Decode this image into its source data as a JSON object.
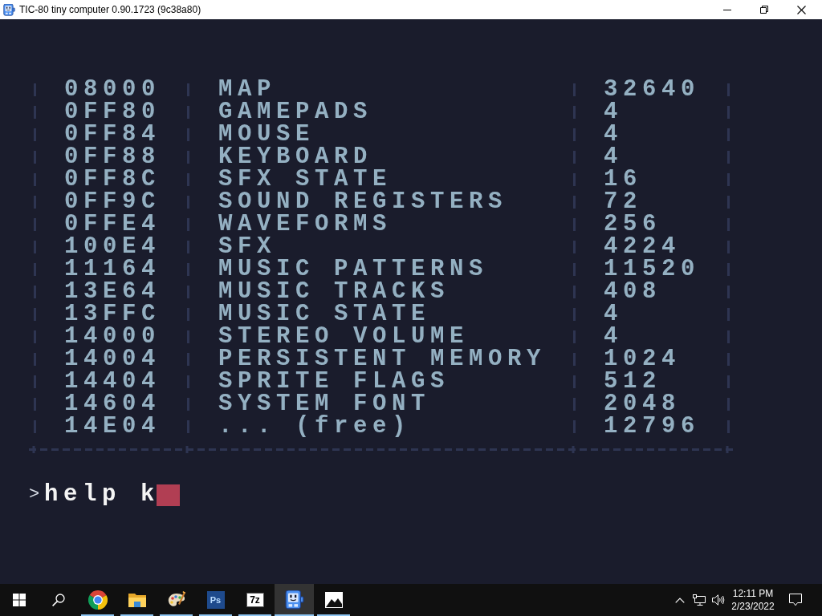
{
  "window": {
    "title": "TIC-80 tiny computer 0.90.1723 (9c38a80)"
  },
  "memory_map": [
    {
      "address": "08000",
      "region": "MAP",
      "size": "32640"
    },
    {
      "address": "0FF80",
      "region": "GAMEPADS",
      "size": "4"
    },
    {
      "address": "0FF84",
      "region": "MOUSE",
      "size": "4"
    },
    {
      "address": "0FF88",
      "region": "KEYBOARD",
      "size": "4"
    },
    {
      "address": "0FF8C",
      "region": "SFX STATE",
      "size": "16"
    },
    {
      "address": "0FF9C",
      "region": "SOUND REGISTERS",
      "size": "72"
    },
    {
      "address": "0FFE4",
      "region": "WAVEFORMS",
      "size": "256"
    },
    {
      "address": "100E4",
      "region": "SFX",
      "size": "4224"
    },
    {
      "address": "11164",
      "region": "MUSIC PATTERNS",
      "size": "11520"
    },
    {
      "address": "13E64",
      "region": "MUSIC TRACKS",
      "size": "408"
    },
    {
      "address": "13FFC",
      "region": "MUSIC STATE",
      "size": "4"
    },
    {
      "address": "14000",
      "region": "STEREO VOLUME",
      "size": "4"
    },
    {
      "address": "14004",
      "region": "PERSISTENT MEMORY",
      "size": "1024"
    },
    {
      "address": "14404",
      "region": "SPRITE FLAGS",
      "size": "512"
    },
    {
      "address": "14604",
      "region": "SYSTEM FONT",
      "size": "2048"
    },
    {
      "address": "14E04",
      "region": "... (free)",
      "size": "12796"
    }
  ],
  "prompt": {
    "symbol": ">",
    "input": "help k",
    "cursor": true
  },
  "taskbar": {
    "apps": [
      {
        "kind": "browser",
        "running": true,
        "selected": false
      },
      {
        "kind": "folder",
        "running": true,
        "selected": false
      },
      {
        "kind": "palette",
        "running": true,
        "selected": false
      },
      {
        "kind": "darktile",
        "label": "Ps",
        "running": true,
        "selected": false
      },
      {
        "kind": "lighttile",
        "label": "7z",
        "running": true,
        "selected": false
      },
      {
        "kind": "robot",
        "running": true,
        "selected": true
      },
      {
        "kind": "photos",
        "running": true,
        "selected": false
      }
    ],
    "clock": {
      "time": "12:11 PM",
      "date": "2/23/2022"
    }
  }
}
